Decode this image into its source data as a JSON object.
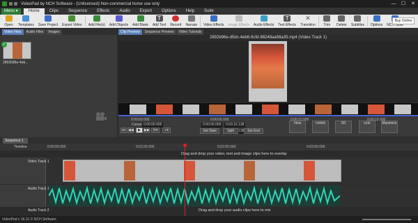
{
  "window": {
    "title": "VideoPad by NCH Software - (Unlicensed) Non-commercial home use only",
    "controls": [
      "—",
      "☐",
      "✕"
    ]
  },
  "menu": {
    "menu_button": "Menu ▾",
    "tabs": [
      "Home",
      "Clips",
      "Sequence",
      "Effects",
      "Audio",
      "Export",
      "Options",
      "Help",
      "Suite"
    ],
    "active_tab": "Home"
  },
  "ribbon": {
    "buttons": [
      {
        "label": "Open",
        "icon": "folder-icon",
        "color": "#e0a020"
      },
      {
        "label": "Templates",
        "icon": "templates-icon",
        "color": "#4a8fd6"
      },
      {
        "label": "Save Project",
        "icon": "save-icon",
        "color": "#3a6fc4"
      },
      {
        "label": "Export Video",
        "icon": "export-video-icon",
        "color": "#4c8f3a"
      },
      {
        "label": "Add File(s)",
        "icon": "add-file-icon",
        "color": "#3a8a3a"
      },
      {
        "label": "Add Objects",
        "icon": "add-objects-icon",
        "color": "#5a5ad0"
      },
      {
        "label": "Add Blank",
        "icon": "add-blank-icon",
        "color": "#3a8a3a"
      },
      {
        "label": "Add Text",
        "icon": "add-text-icon",
        "color": "#555555"
      },
      {
        "label": "Record",
        "icon": "record-icon",
        "color": "#d03030"
      },
      {
        "label": "Narrate",
        "icon": "narrate-icon",
        "color": "#777777"
      },
      {
        "label": "Video Effects",
        "icon": "video-effects-icon",
        "color": "#3a6fc4"
      },
      {
        "label": "Image Effects",
        "icon": "image-effects-icon",
        "color": "#999999",
        "disabled": true
      },
      {
        "label": "Audio Effects",
        "icon": "audio-effects-icon",
        "color": "#3aa0c4"
      },
      {
        "label": "Text Effects",
        "icon": "text-effects-icon",
        "color": "#555555"
      },
      {
        "label": "Transition",
        "icon": "transition-icon",
        "color": "#555555"
      },
      {
        "label": "Trim",
        "icon": "trim-icon",
        "color": "#555555"
      },
      {
        "label": "Delete",
        "icon": "delete-icon",
        "color": "#555555"
      },
      {
        "label": "Subtitles",
        "icon": "subtitles-icon",
        "color": "#555555"
      },
      {
        "label": "Options",
        "icon": "options-icon",
        "color": "#3a6fc4"
      },
      {
        "label": "NCH Suite",
        "icon": "nch-suite-icon",
        "color": "#3a6fc4"
      }
    ],
    "buy_now": "Buy Online"
  },
  "media_panel": {
    "tabs": [
      "Video Files",
      "Audio Files",
      "Images"
    ],
    "active_tab": "Video Files",
    "clip_name": "2892b96e-4eb..."
  },
  "preview": {
    "tabs": [
      "Clip Preview",
      "Sequence Preview",
      "Video Tutorials"
    ],
    "active_tab": "Clip Preview",
    "clip_title": "2892b96e-d5dc-4eb6-9cfd-98248aa56a35.mp4 (Video Track 1)",
    "filmstrip_times": [
      "0:00:00.000",
      "0:00:05.000",
      "0:00:10.000",
      "0:00:15.000"
    ],
    "cursor_label": "Cursor:",
    "cursor_time": "0:00:00.000",
    "time_a": "0:00:00.000",
    "time_b": "0:03:16.138",
    "time_c": "0:03:16.138",
    "set_start": "Set Start",
    "split": "Split",
    "set_end": "Set End",
    "view_label": "View",
    "unlink_label": "Unlink",
    "threed_label": "3D",
    "link_label": "Link",
    "maximize_label": "Maximize"
  },
  "sequence": {
    "tab": "Sequence 1",
    "timeline_label": "Timeline",
    "ruler_times": [
      "0:00:00.000",
      "0:01:00.000",
      "0:02:00.000",
      "0:03:00.000"
    ],
    "video_overlay_hint": "Drag and drop your video, text and image clips here to overlay",
    "video_track": "Video Track 1",
    "audio_track": "Audio Track 1",
    "audio_drop_hint": "Drag and drop your audio clips here to mix",
    "audio_track_2": "Audio Track 2"
  },
  "status": {
    "text": "VideoPad v 16.31 © NCH Software"
  }
}
